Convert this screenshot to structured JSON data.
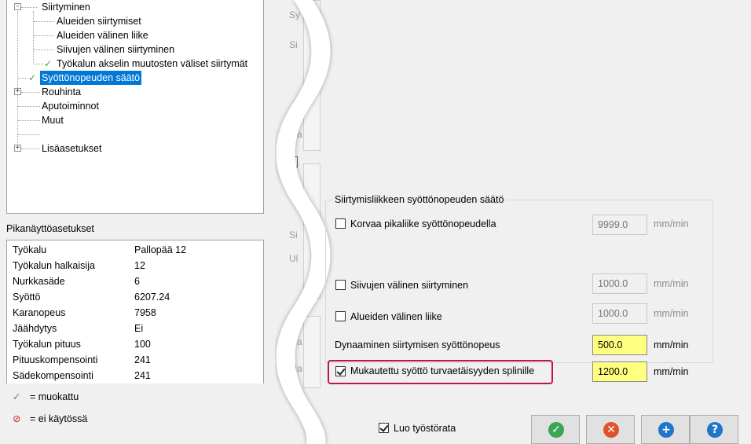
{
  "tree": {
    "items": [
      {
        "label": "Siirtyminen"
      },
      {
        "label": "Alueiden siirtymiset"
      },
      {
        "label": "Alueiden välinen liike"
      },
      {
        "label": "Siivujen välinen siirtyminen"
      },
      {
        "label": "Työkalun akselin muutosten väliset siirtymät"
      },
      {
        "label": "Syöttönopeuden säätö"
      },
      {
        "label": "Rouhinta"
      },
      {
        "label": "Aputoiminnot"
      },
      {
        "label": "Muut"
      },
      {
        "label": "Lisäasetukset"
      }
    ],
    "expand_symbol": "-",
    "collapse_symbol": "+",
    "check_symbol": "✓"
  },
  "quick_info": {
    "title": "Pikanäyttöasetukset",
    "rows": [
      {
        "key": "Työkalu",
        "value": "Pallopää 12"
      },
      {
        "key": "Työkalun halkaisija",
        "value": "12"
      },
      {
        "key": "Nurkkasäde",
        "value": "6"
      },
      {
        "key": "Syöttö",
        "value": "6207.24"
      },
      {
        "key": "Karanopeus",
        "value": "7958"
      },
      {
        "key": "Jäähdytys",
        "value": "Ei"
      },
      {
        "key": "Työkalun pituus",
        "value": "100"
      },
      {
        "key": "Pituuskompensointi",
        "value": "241"
      },
      {
        "key": "Sädekompensointi",
        "value": "241"
      }
    ]
  },
  "legend": {
    "modified_symbol": "✓",
    "modified_label": "= muokattu",
    "disabled_symbol": "⊘",
    "disabled_label": "= ei käytössä"
  },
  "mid_ghost": [
    "Sy",
    "Si",
    "Ma",
    "Si",
    "Ul",
    "Ma",
    "Ma"
  ],
  "feed_group": {
    "title": "Siirtymisliikkeen syöttönopeuden säätö",
    "replace_rapid": {
      "label": "Korvaa pikaliike syöttönopeudella",
      "checked": false,
      "value": "9999.0",
      "unit": "mm/min"
    },
    "slice_transition": {
      "label": "Siivujen välinen siirtyminen",
      "checked": false,
      "value": "1000.0",
      "unit": "mm/min"
    },
    "area_move": {
      "label": "Alueiden välinen liike",
      "checked": false,
      "value": "1000.0",
      "unit": "mm/min"
    },
    "dynamic": {
      "label": "Dynaaminen siirtymisen syöttönopeus",
      "value": "500.0",
      "unit": "mm/min"
    },
    "adapted": {
      "label": "Mukautettu syöttö turvaetäisyyden splinille",
      "checked": true,
      "value": "1200.0",
      "unit": "mm/min"
    }
  },
  "footer": {
    "create_toolpath": {
      "label": "Luo työstörata",
      "checked": true
    },
    "buttons": [
      {
        "name": "ok-button",
        "icon": "✓",
        "color": "#3aa655"
      },
      {
        "name": "cancel-button",
        "icon": "✕",
        "color": "#e0522c"
      },
      {
        "name": "add-button",
        "icon": "+",
        "color": "#1f75c9"
      },
      {
        "name": "help-button",
        "icon": "?",
        "color": "#1f75c9"
      }
    ]
  },
  "colors": {
    "selection": "#0078d7",
    "highlight_field": "#ffff80",
    "callout": "#c0144a",
    "check": "#3aa63a",
    "disabled": "#d42020"
  }
}
